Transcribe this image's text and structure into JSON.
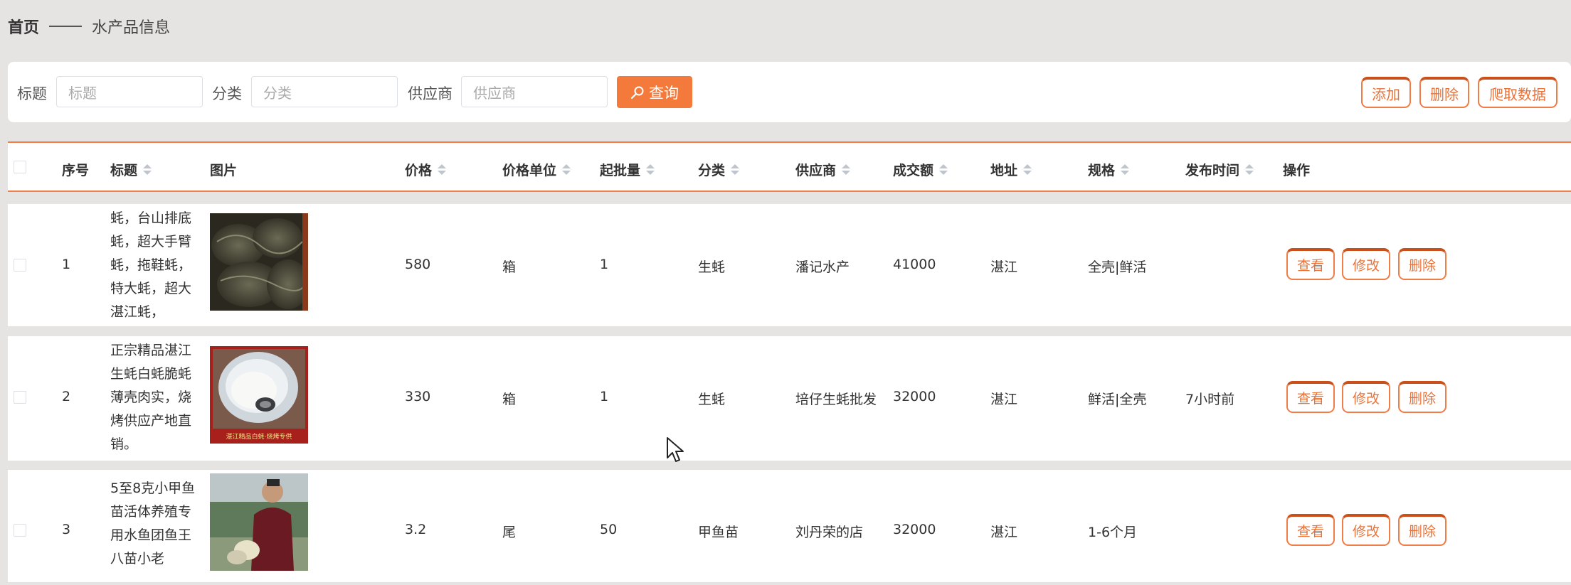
{
  "breadcrumb": {
    "home": "首页",
    "current": "水产品信息"
  },
  "search": {
    "title_label": "标题",
    "title_placeholder": "标题",
    "category_label": "分类",
    "category_placeholder": "分类",
    "supplier_label": "供应商",
    "supplier_placeholder": "供应商",
    "query_label": "查询"
  },
  "toolbar": {
    "add_label": "添加",
    "delete_label": "删除",
    "crawl_label": "爬取数据"
  },
  "table": {
    "headers": [
      "序号",
      "标题",
      "图片",
      "价格",
      "价格单位",
      "起批量",
      "分类",
      "供应商",
      "成交额",
      "地址",
      "规格",
      "发布时间",
      "操作"
    ],
    "rows": [
      {
        "index": "1",
        "title_lines": [
          "蚝，台山排底",
          "蚝，超大手臂",
          "蚝，拖鞋蚝，",
          "特大蚝，超大",
          "湛江蚝，"
        ],
        "price": "580",
        "unit": "箱",
        "min_qty": "1",
        "category": "生蚝",
        "supplier": "潘记水产",
        "turnover": "41000",
        "address": "湛江",
        "spec": "全壳|鲜活",
        "publish_time": "",
        "view": "查看",
        "edit": "修改",
        "delete": "删除"
      },
      {
        "index": "2",
        "title_lines": [
          "正宗精品湛江",
          "生蚝白蚝脆蚝",
          "薄壳肉实，烧",
          "烤供应产地直",
          "销。"
        ],
        "price": "330",
        "unit": "箱",
        "min_qty": "1",
        "category": "生蚝",
        "supplier": "培仔生蚝批发",
        "turnover": "32000",
        "address": "湛江",
        "spec": "鲜活|全壳",
        "publish_time": "7小时前",
        "image_caption": "湛江精品白蚝·烧烤专供",
        "view": "查看",
        "edit": "修改",
        "delete": "删除"
      },
      {
        "index": "3",
        "title_lines": [
          "5至8克小甲鱼",
          "苗活体养殖专",
          "用水鱼团鱼王",
          "八苗小老"
        ],
        "price": "3.2",
        "unit": "尾",
        "min_qty": "50",
        "category": "甲鱼苗",
        "supplier": "刘丹荣的店",
        "turnover": "32000",
        "address": "湛江",
        "spec": "1-6个月",
        "publish_time": "",
        "view": "查看",
        "edit": "修改",
        "delete": "删除"
      }
    ]
  },
  "colors": {
    "accent": "#f47a3c",
    "accent_dark": "#c9501a",
    "background": "#e6e4e2"
  }
}
